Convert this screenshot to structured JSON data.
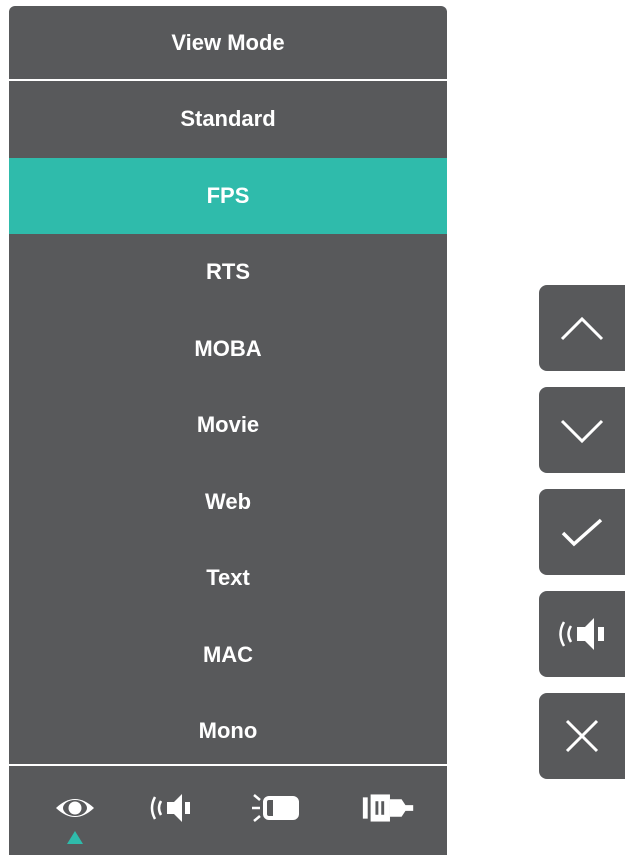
{
  "osd": {
    "title": "View Mode",
    "items": [
      {
        "label": "Standard",
        "selected": false
      },
      {
        "label": "FPS",
        "selected": true
      },
      {
        "label": "RTS",
        "selected": false
      },
      {
        "label": "MOBA",
        "selected": false
      },
      {
        "label": "Movie",
        "selected": false
      },
      {
        "label": "Web",
        "selected": false
      },
      {
        "label": "Text",
        "selected": false
      },
      {
        "label": "MAC",
        "selected": false
      },
      {
        "label": "Mono",
        "selected": false
      }
    ],
    "tabs": [
      {
        "icon": "eye-icon",
        "active": true
      },
      {
        "icon": "speaker-icon",
        "active": false
      },
      {
        "icon": "display-brightness-icon",
        "active": false
      },
      {
        "icon": "input-connector-icon",
        "active": false
      }
    ]
  },
  "keys": [
    {
      "icon": "chevron-up-icon"
    },
    {
      "icon": "chevron-down-icon"
    },
    {
      "icon": "checkmark-icon"
    },
    {
      "icon": "speaker-icon"
    },
    {
      "icon": "close-icon"
    }
  ],
  "colors": {
    "panel": "#58595b",
    "highlight": "#2fbbab",
    "text": "#ffffff"
  }
}
